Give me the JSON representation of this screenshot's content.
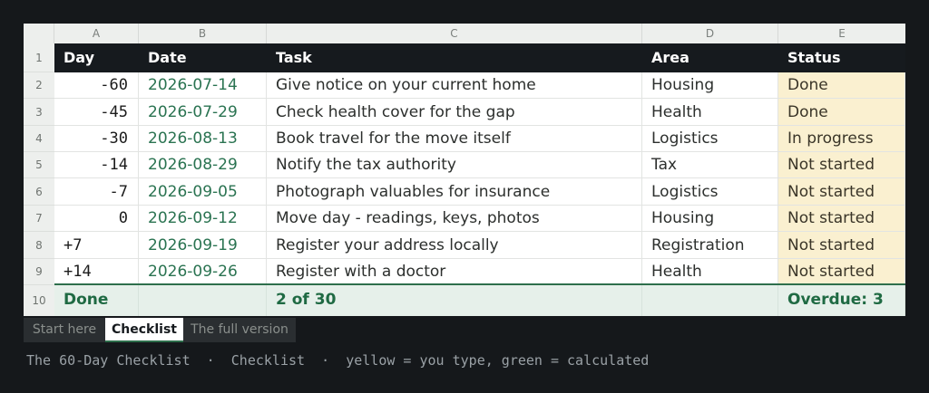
{
  "columns": [
    "A",
    "B",
    "C",
    "D",
    "E"
  ],
  "row_numbers": [
    "1",
    "2",
    "3",
    "4",
    "5",
    "6",
    "7",
    "8",
    "9",
    "10"
  ],
  "header": {
    "day": "Day",
    "date": "Date",
    "task": "Task",
    "area": "Area",
    "status": "Status"
  },
  "rows": [
    {
      "day": "-60",
      "date": "2026-07-14",
      "task": "Give notice on your current home",
      "area": "Housing",
      "status": "Done"
    },
    {
      "day": "-45",
      "date": "2026-07-29",
      "task": "Check health cover for the gap",
      "area": "Health",
      "status": "Done"
    },
    {
      "day": "-30",
      "date": "2026-08-13",
      "task": "Book travel for the move itself",
      "area": "Logistics",
      "status": "In progress"
    },
    {
      "day": "-14",
      "date": "2026-08-29",
      "task": "Notify the tax authority",
      "area": "Tax",
      "status": "Not started"
    },
    {
      "day": "-7",
      "date": "2026-09-05",
      "task": "Photograph valuables for insurance",
      "area": "Logistics",
      "status": "Not started"
    },
    {
      "day": "0",
      "date": "2026-09-12",
      "task": "Move day - readings, keys, photos",
      "area": "Housing",
      "status": "Not started"
    },
    {
      "day": "+7",
      "date": "2026-09-19",
      "task": "Register your address locally",
      "area": "Registration",
      "status": "Not started"
    },
    {
      "day": "+14",
      "date": "2026-09-26",
      "task": "Register with a doctor",
      "area": "Health",
      "status": "Not started"
    }
  ],
  "footer": {
    "label": "Done",
    "count": "2 of 30",
    "overdue": "Overdue: 3"
  },
  "tabs": [
    {
      "label": "Start here",
      "active": false
    },
    {
      "label": "Checklist",
      "active": true
    },
    {
      "label": "The full version",
      "active": false
    }
  ],
  "caption": "The 60-Day Checklist  ·  Checklist  ·  yellow = you type, green = calculated",
  "colors": {
    "header_bg": "#161a1e",
    "input_yellow": "#faf0d0",
    "calc_green": "#2a7351",
    "footer_bg": "#e6f0ea"
  }
}
